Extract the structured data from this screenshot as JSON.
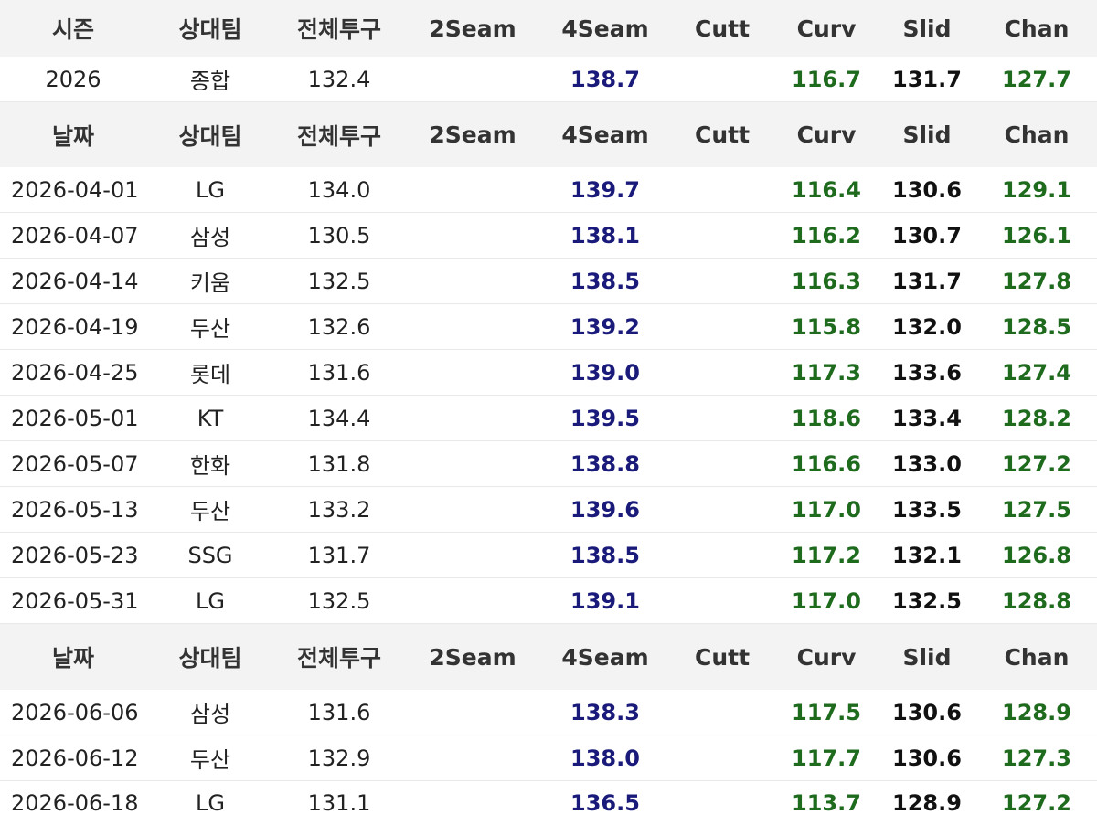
{
  "season_section": {
    "headers": [
      "시즌",
      "상대팀",
      "전체투구",
      "2Seam",
      "4Seam",
      "Cutt",
      "Curv",
      "Slid",
      "Chan"
    ],
    "row": [
      "2026",
      "종합",
      "132.4",
      "",
      "138.7",
      "",
      "116.7",
      "131.7",
      "127.7"
    ]
  },
  "game_section_1": {
    "headers": [
      "날짜",
      "상대팀",
      "전체투구",
      "2Seam",
      "4Seam",
      "Cutt",
      "Curv",
      "Slid",
      "Chan"
    ],
    "rows": [
      [
        "2026-04-01",
        "LG",
        "134.0",
        "",
        "139.7",
        "",
        "116.4",
        "130.6",
        "129.1"
      ],
      [
        "2026-04-07",
        "삼성",
        "130.5",
        "",
        "138.1",
        "",
        "116.2",
        "130.7",
        "126.1"
      ],
      [
        "2026-04-14",
        "키움",
        "132.5",
        "",
        "138.5",
        "",
        "116.3",
        "131.7",
        "127.8"
      ],
      [
        "2026-04-19",
        "두산",
        "132.6",
        "",
        "139.2",
        "",
        "115.8",
        "132.0",
        "128.5"
      ],
      [
        "2026-04-25",
        "롯데",
        "131.6",
        "",
        "139.0",
        "",
        "117.3",
        "133.6",
        "127.4"
      ],
      [
        "2026-05-01",
        "KT",
        "134.4",
        "",
        "139.5",
        "",
        "118.6",
        "133.4",
        "128.2"
      ],
      [
        "2026-05-07",
        "한화",
        "131.8",
        "",
        "138.8",
        "",
        "116.6",
        "133.0",
        "127.2"
      ],
      [
        "2026-05-13",
        "두산",
        "133.2",
        "",
        "139.6",
        "",
        "117.0",
        "133.5",
        "127.5"
      ],
      [
        "2026-05-23",
        "SSG",
        "131.7",
        "",
        "138.5",
        "",
        "117.2",
        "132.1",
        "126.8"
      ],
      [
        "2026-05-31",
        "LG",
        "132.5",
        "",
        "139.1",
        "",
        "117.0",
        "132.5",
        "128.8"
      ]
    ]
  },
  "game_section_2": {
    "headers": [
      "날짜",
      "상대팀",
      "전체투구",
      "2Seam",
      "4Seam",
      "Cutt",
      "Curv",
      "Slid",
      "Chan"
    ],
    "rows": [
      [
        "2026-06-06",
        "삼성",
        "131.6",
        "",
        "138.3",
        "",
        "117.5",
        "130.6",
        "128.9"
      ],
      [
        "2026-06-12",
        "두산",
        "132.9",
        "",
        "138.0",
        "",
        "117.7",
        "130.6",
        "127.3"
      ],
      [
        "2026-06-18",
        "LG",
        "131.1",
        "",
        "136.5",
        "",
        "113.7",
        "128.9",
        "127.2"
      ]
    ]
  },
  "colors": {
    "header_bg": "#f3f3f3",
    "fourseam_text": "#1a1a7a",
    "green_text": "#1e6b1e"
  }
}
